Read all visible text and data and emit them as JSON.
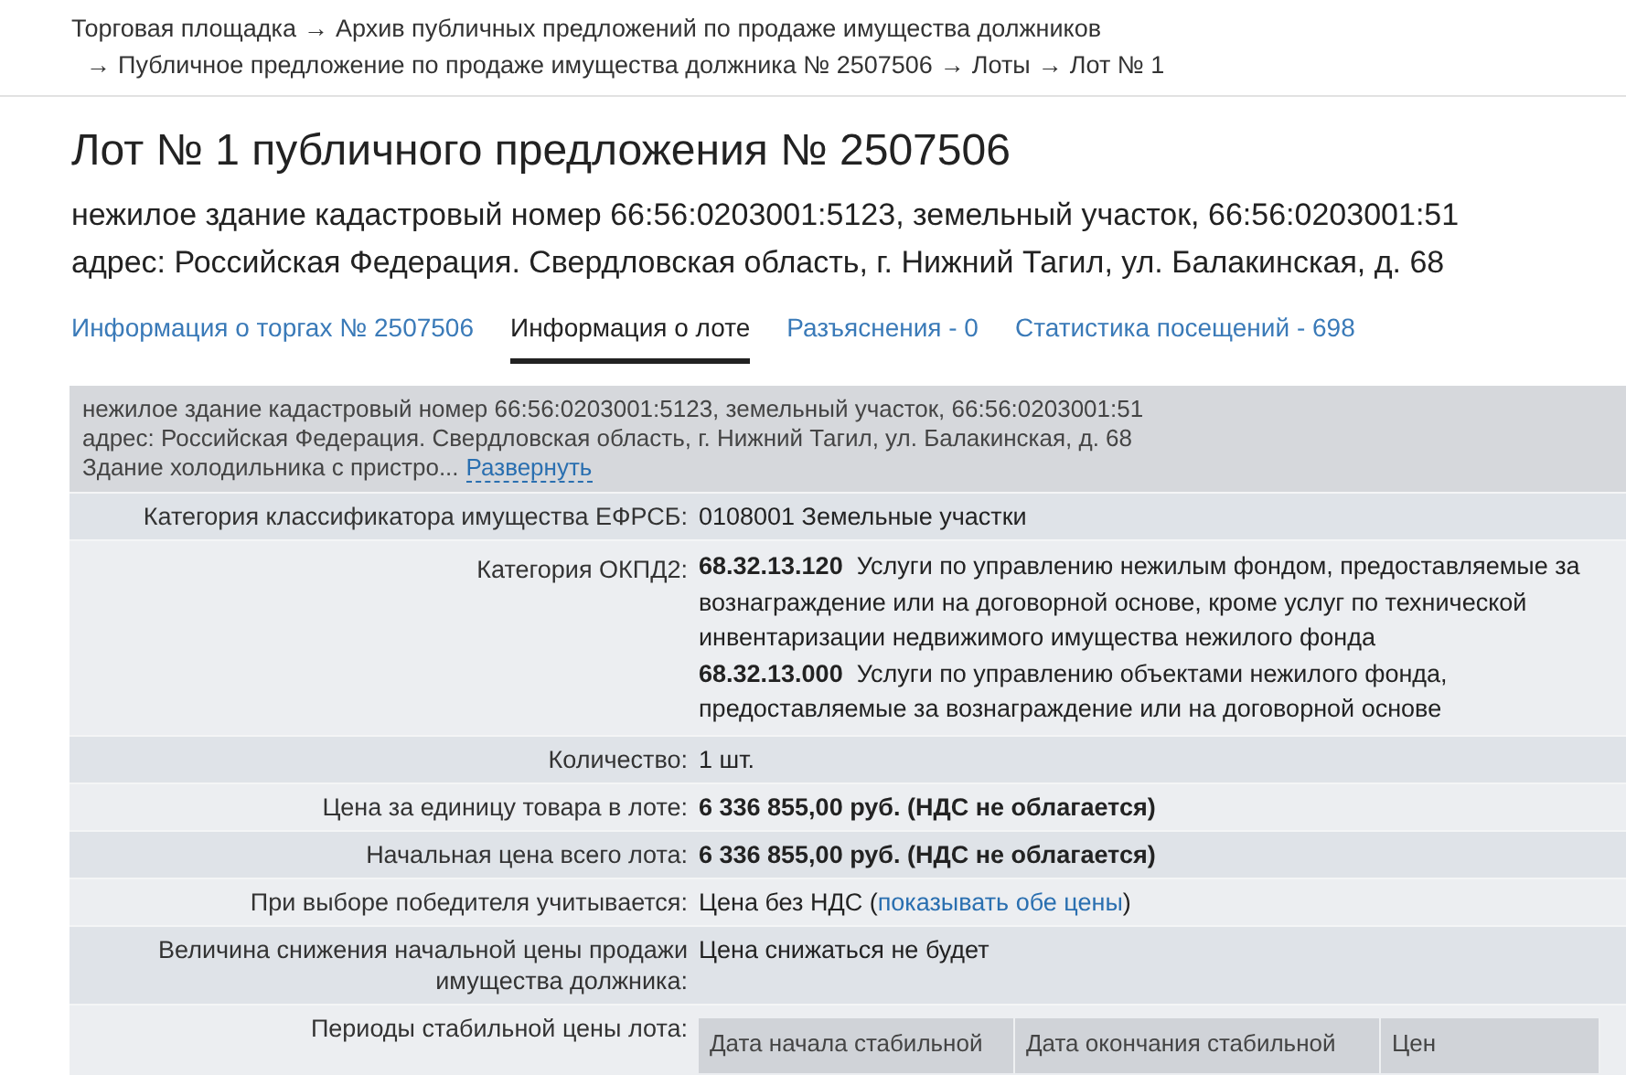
{
  "breadcrumbs": {
    "separator": "→",
    "lines": [
      [
        "Торговая площадка",
        "Архив публичных предложений по продаже имущества должников"
      ],
      [
        "Публичное предложение по продаже имущества должника № 2507506",
        "Лоты",
        "Лот № 1"
      ]
    ]
  },
  "title": "Лот № 1 публичного предложения № 2507506",
  "subtitle": [
    "нежилое здание кадастровый номер 66:56:0203001:5123, земельный участок, 66:56:0203001:51",
    "адрес: Российская Федерация. Свердловская область, г. Нижний Тагил, ул. Балакинская, д. 68"
  ],
  "tabs": [
    {
      "label": "Информация о торгах № 2507506",
      "selected": false
    },
    {
      "label": "Информация о лоте",
      "selected": true
    },
    {
      "label": "Разъяснения - 0",
      "selected": false
    },
    {
      "label": "Статистика посещений - 698",
      "selected": false
    }
  ],
  "description": {
    "lines": [
      "нежилое здание кадастровый номер 66:56:0203001:5123, земельный участок, 66:56:0203001:51",
      "адрес: Российская Федерация. Свердловская область, г. Нижний Тагил, ул. Балакинская, д. 68",
      "Здание холодильника с пристро..."
    ],
    "expand_link": "Развернуть"
  },
  "fields": [
    {
      "kind": "text",
      "label": "Категория классификатора имущества ЕФРСБ:",
      "value": "0108001 Земельные участки"
    },
    {
      "kind": "codes",
      "label": "Категория ОКПД2:",
      "codes": [
        {
          "code": "68.32.13.120",
          "text": "Услуги по управлению нежилым фондом, предоставляемые за вознаграждение или на договорной основе, кроме услуг по технической инвентаризации недвижимого имущества нежилого фонда"
        },
        {
          "code": "68.32.13.000",
          "text": "Услуги по управлению объектами нежилого фонда, предоставляемые за вознаграждение или на договорной основе"
        }
      ]
    },
    {
      "kind": "text",
      "label": "Количество:",
      "value": "1 шт."
    },
    {
      "kind": "bold",
      "label": "Цена за единицу товара в лоте:",
      "value": "6 336 855,00 руб. (НДС не облагается)"
    },
    {
      "kind": "bold",
      "label": "Начальная цена всего лота:",
      "value": "6 336 855,00 руб. (НДС не облагается)"
    },
    {
      "kind": "link",
      "label": "При выборе победителя учитывается:",
      "before": "Цена без НДС (",
      "link": "показывать обе цены",
      "after": ")"
    },
    {
      "kind": "text",
      "label": "Величина снижения начальной цены продажи имущества должника:",
      "value": "Цена снижаться не будет"
    },
    {
      "kind": "periods",
      "label": "Периоды стабильной цены лота:",
      "columns": [
        "Дата начала стабильной",
        "Дата окончания стабильной",
        "Цен"
      ]
    }
  ]
}
